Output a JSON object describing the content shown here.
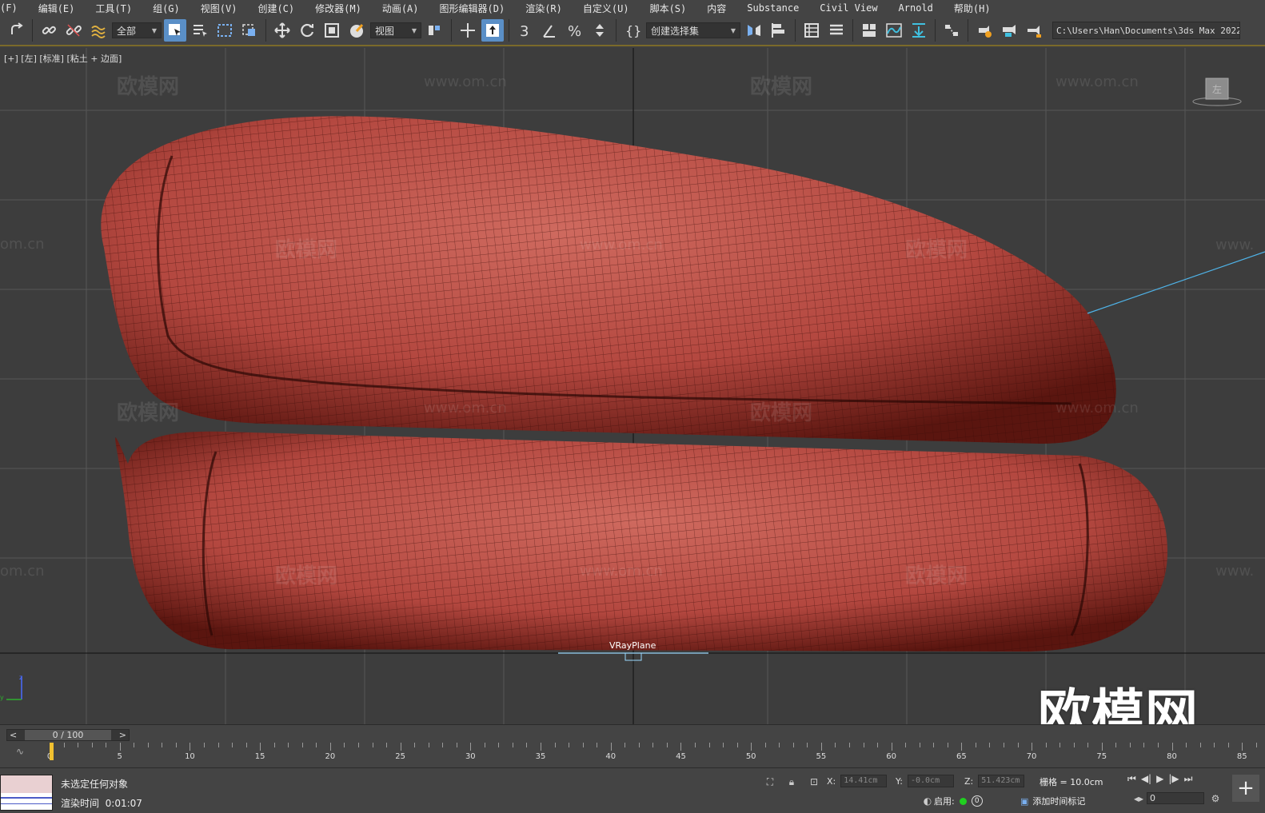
{
  "menu": [
    {
      "label": "(F)"
    },
    {
      "label": "编辑(E)"
    },
    {
      "label": "工具(T)"
    },
    {
      "label": "组(G)"
    },
    {
      "label": "视图(V)"
    },
    {
      "label": "创建(C)"
    },
    {
      "label": "修改器(M)"
    },
    {
      "label": "动画(A)"
    },
    {
      "label": "图形编辑器(D)"
    },
    {
      "label": "渲染(R)"
    },
    {
      "label": "自定义(U)"
    },
    {
      "label": "脚本(S)"
    },
    {
      "label": "内容"
    },
    {
      "label": "Substance"
    },
    {
      "label": "Civil View"
    },
    {
      "label": "Arnold"
    },
    {
      "label": "帮助(H)"
    }
  ],
  "toolbar": {
    "filter_value": "全部",
    "view_value": "视图",
    "selection_set_value": "创建选择集",
    "project_path": "C:\\Users\\Han\\Documents\\3ds Max 2022",
    "icons": [
      "redo-icon",
      "link-icon",
      "unlink-icon",
      "bind-space-warp-icon",
      "select-object-icon",
      "select-by-name-icon",
      "rect-region-icon",
      "window-crossing-icon",
      "move-icon",
      "rotate-icon",
      "scale-icon",
      "place-icon",
      "pivot-icon",
      "snap-3d-icon",
      "angle-snap-icon",
      "percent-snap-icon",
      "spinner-snap-icon",
      "edit-named-sets-icon",
      "mirror-icon",
      "align-icon",
      "layer-explorer-icon",
      "toggle-ribbon-icon",
      "graph-editor-icon",
      "schematic-view-icon",
      "material-editor-icon",
      "render-setup-icon",
      "render-frame-icon",
      "render-icon"
    ],
    "accent": "#5a8fc7"
  },
  "viewport": {
    "label": "[+] [左] [标准] [粘土 + 边面]",
    "object_label": "VRayPlane",
    "watermark_cn": "欧模网",
    "watermark_url": "www.om.cn",
    "watermark_url_cut": "om.cn",
    "watermark_url_head": "www.",
    "logo_text": "欧模网",
    "viewcube_label": "左",
    "mesh_color": "#b3473f",
    "grid_color": "#575757"
  },
  "timeline": {
    "frame_display": "0 / 100",
    "ticks": [
      "0",
      "5",
      "10",
      "15",
      "20",
      "25",
      "30",
      "35",
      "40",
      "45",
      "50",
      "55",
      "60",
      "65",
      "70",
      "75",
      "80",
      "85"
    ]
  },
  "status": {
    "message": "未选定任何对象",
    "render_time_label": "渲染时间",
    "render_time": "0:01:07",
    "x_label": "X:",
    "x_value": "14.41cm",
    "y_label": "Y:",
    "y_value": "-0.0cm",
    "z_label": "Z:",
    "z_value": "51.423cm",
    "grid": "栅格 = 10.0cm",
    "enable_label": "启用:",
    "enable_count": "0",
    "add_time_tag": "添加时间标记",
    "frame_value": "0"
  }
}
